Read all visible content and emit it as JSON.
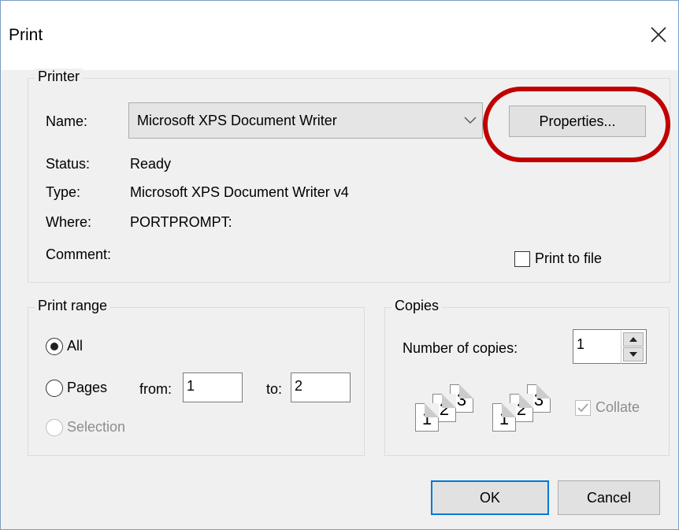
{
  "window": {
    "title": "Print"
  },
  "printer": {
    "group_label": "Printer",
    "name_label": "Name:",
    "name_value": "Microsoft XPS Document Writer",
    "properties_button": "Properties...",
    "status_label": "Status:",
    "status_value": "Ready",
    "type_label": "Type:",
    "type_value": "Microsoft XPS Document Writer v4",
    "where_label": "Where:",
    "where_value": "PORTPROMPT:",
    "comment_label": "Comment:",
    "print_to_file_label": "Print to file",
    "print_to_file_checked": false
  },
  "print_range": {
    "group_label": "Print range",
    "all_label": "All",
    "pages_label": "Pages",
    "from_label": "from:",
    "from_value": "1",
    "to_label": "to:",
    "to_value": "2",
    "selection_label": "Selection",
    "selected": "All"
  },
  "copies": {
    "group_label": "Copies",
    "number_label": "Number of copies:",
    "number_value": "1",
    "collate_label": "Collate",
    "collate_checked": true,
    "collate_enabled": false,
    "page_numbers": [
      "1",
      "2",
      "3"
    ]
  },
  "buttons": {
    "ok": "OK",
    "cancel": "Cancel"
  },
  "colors": {
    "highlight": "#c00000",
    "default_button_border": "#0078d7"
  }
}
